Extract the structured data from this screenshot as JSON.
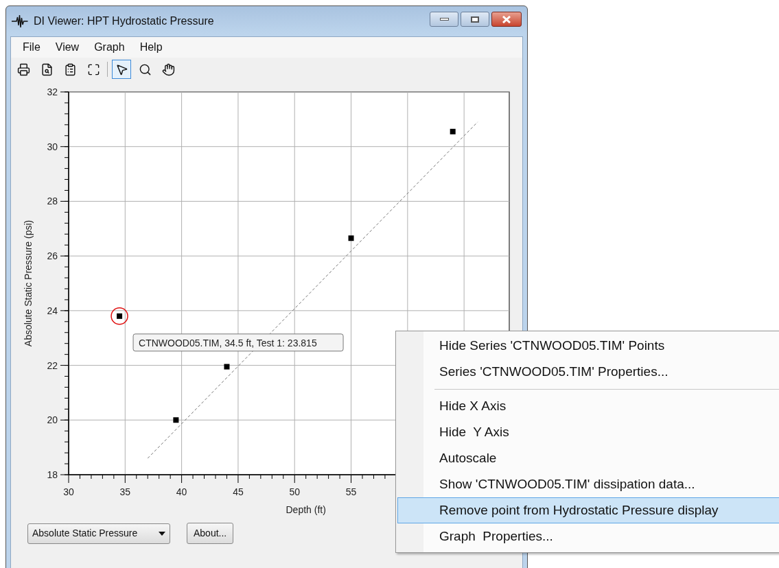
{
  "window": {
    "title": "DI Viewer: HPT Hydrostatic Pressure"
  },
  "menu_bar": [
    "File",
    "View",
    "Graph",
    "Help"
  ],
  "toolbar": [
    {
      "kind": "print",
      "selected": false
    },
    {
      "kind": "preview",
      "selected": false
    },
    {
      "kind": "properties",
      "selected": false
    },
    {
      "kind": "fit",
      "selected": false
    },
    {
      "kind": "pointer",
      "selected": true
    },
    {
      "kind": "zoom",
      "selected": false
    },
    {
      "kind": "pan",
      "selected": false
    }
  ],
  "chart": {
    "chart_data": {
      "type": "scatter",
      "grid": true,
      "xlabel": "Depth (ft)",
      "ylabel": "Absolute Static Pressure (psi)",
      "xlim": [
        30,
        69
      ],
      "ylim": [
        18,
        32
      ],
      "xticks": [
        30,
        35,
        40,
        45,
        50,
        55
      ],
      "yticks": [
        18,
        20,
        22,
        24,
        26,
        28,
        30,
        32
      ],
      "series": [
        {
          "color": "#000000",
          "x": [
            34.5,
            39.5,
            44,
            55,
            64
          ],
          "values": [
            23.8,
            20.0,
            21.95,
            26.65,
            30.55
          ]
        },
        {
          "type": "line",
          "line_style": "dashed",
          "color": "#777777",
          "x": [
            37,
            66.2
          ],
          "values": [
            18.6,
            30.9
          ]
        }
      ]
    },
    "points": [
      {
        "selected": true
      },
      {
        "selected": false
      },
      {
        "selected": false
      },
      {
        "selected": false
      },
      {
        "selected": false
      }
    ],
    "tooltip": "CTNWOOD05.TIM, 34.5 ft, Test 1: 23.815"
  },
  "series_select": {
    "value": "Absolute Static Pressure"
  },
  "about_button": "About...",
  "context_menu": [
    {
      "kind": "item",
      "label": "Hide Series 'CTNWOOD05.TIM' Points",
      "selected": false
    },
    {
      "kind": "item",
      "label": "Series 'CTNWOOD05.TIM' Properties...",
      "selected": false
    },
    {
      "kind": "separator"
    },
    {
      "kind": "item",
      "label": "Hide X Axis",
      "selected": false
    },
    {
      "kind": "item",
      "label": "Hide  Y Axis",
      "selected": false
    },
    {
      "kind": "item",
      "label": "Autoscale",
      "selected": false
    },
    {
      "kind": "item",
      "label": "Show 'CTNWOOD05.TIM' dissipation data...",
      "selected": false
    },
    {
      "kind": "item",
      "label": "Remove point from Hydrostatic Pressure display",
      "selected": true
    },
    {
      "kind": "item",
      "label": "Graph  Properties...",
      "selected": false
    }
  ]
}
